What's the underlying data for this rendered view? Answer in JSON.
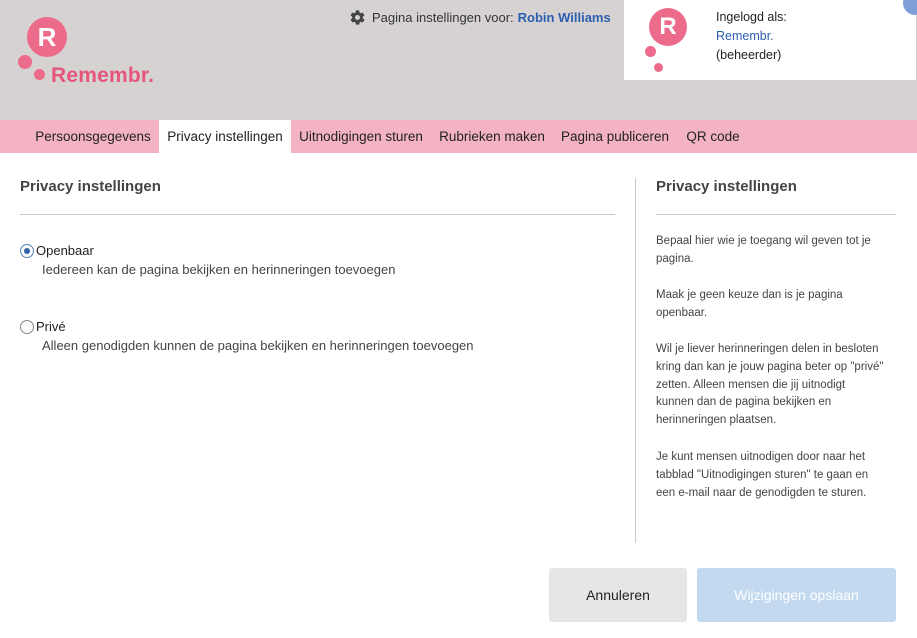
{
  "header": {
    "logo_text": "Remembr.",
    "logo_letter": "R",
    "page_settings_prefix": "Pagina instellingen voor:",
    "page_owner": "Robin Williams"
  },
  "user": {
    "avatar_letter": "R",
    "logged_in_label": "Ingelogd als:",
    "username": "Remembr.",
    "role": "(beheerder)"
  },
  "tabs": [
    {
      "label": "Persoonsgegevens",
      "active": false
    },
    {
      "label": "Privacy instellingen",
      "active": true
    },
    {
      "label": "Uitnodigingen sturen",
      "active": false
    },
    {
      "label": "Rubrieken maken",
      "active": false
    },
    {
      "label": "Pagina publiceren",
      "active": false
    },
    {
      "label": "QR code",
      "active": false
    }
  ],
  "main": {
    "title": "Privacy instellingen",
    "options": [
      {
        "label": "Openbaar",
        "description": "Iedereen kan de pagina bekijken en herinneringen toevoegen",
        "checked": true
      },
      {
        "label": "Privé",
        "description": "Alleen genodigden kunnen de pagina bekijken en herinneringen toevoegen",
        "checked": false
      }
    ]
  },
  "sidebar": {
    "title": "Privacy instellingen",
    "paragraphs": [
      [
        "Bepaal hier wie je toegang wil geven tot je",
        "pagina."
      ],
      [
        "Maak je geen keuze dan is je pagina",
        "openbaar."
      ],
      [
        "Wil je liever herinneringen delen in besloten",
        "kring dan kan je jouw pagina beter op \"privé\"",
        "zetten. Alleen mensen die jij uitnodigt",
        "kunnen dan de pagina bekijken en",
        "herinneringen plaatsen."
      ],
      [
        "Je kunt mensen uitnodigen door naar het",
        "tabblad \"Uitnodigingen sturen\" te gaan en",
        "een e-mail naar de genodigden te sturen."
      ]
    ]
  },
  "buttons": {
    "cancel": "Annuleren",
    "save": "Wijzigingen opslaan"
  },
  "colors": {
    "brand_pink": "#ec6a8a",
    "tab_bar": "#f4b3c4",
    "header_bg": "#d6d2d2",
    "link_blue": "#2d5fb0",
    "save_disabled": "#c3d9f0"
  },
  "icons": {
    "settings": "gear-icon",
    "radio_checked": "radio-checked-icon",
    "radio_unchecked": "radio-unchecked-icon"
  }
}
